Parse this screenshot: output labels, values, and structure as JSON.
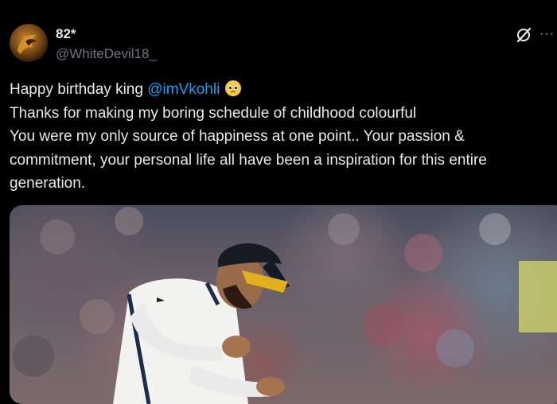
{
  "author": {
    "display_name": "82*",
    "handle": "@WhiteDevil18_"
  },
  "tweet": {
    "line1_prefix": "Happy birthday king ",
    "mention": "@imVkohli",
    "emoji": "pleading-face",
    "body": "Thanks for making my boring schedule of childhood colourful\nYou were my only source of happiness at one point.. Your passion & commitment, your personal life all have been a inspiration for this entire generation."
  },
  "icons": {
    "grok": "grok-icon",
    "more": "more-icon",
    "more_glyph": "···"
  },
  "colors": {
    "background": "#000000",
    "text": "#e7e9ea",
    "secondary": "#71767b",
    "link": "#1d9bf0"
  },
  "media": {
    "description_kind": "photo"
  }
}
